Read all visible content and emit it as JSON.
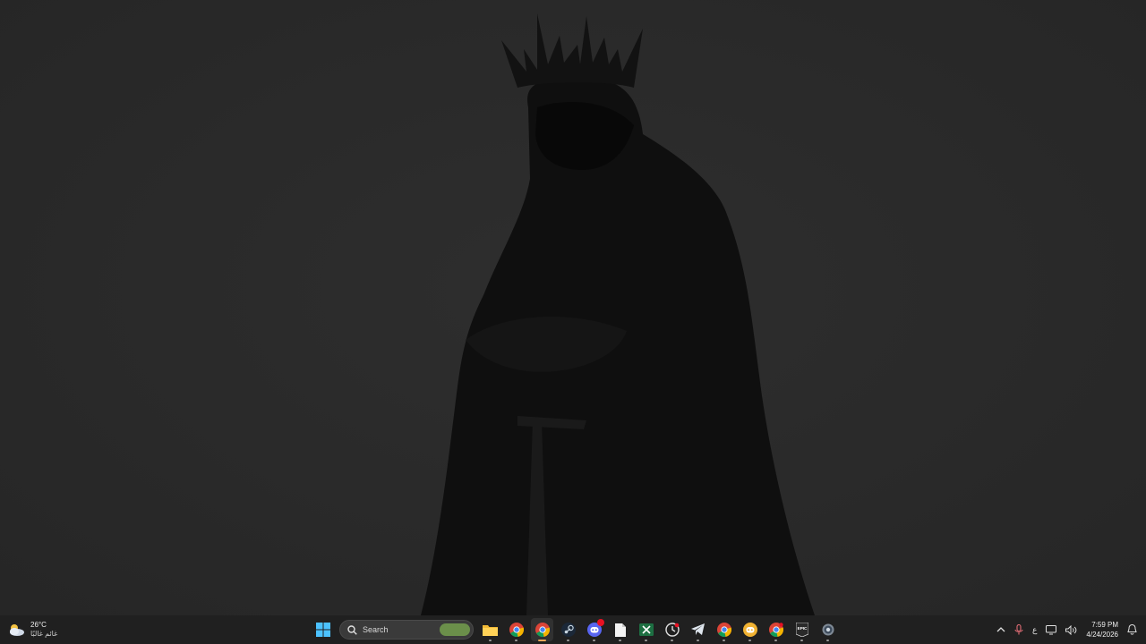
{
  "colors": {
    "desktop_bg": "#2b2b2b",
    "taskbar_bg": "#202020",
    "accent_running": "#e8a657",
    "badge_red": "#e81123"
  },
  "weather": {
    "temperature": "26°C",
    "condition": "غائم غالبًا",
    "icon": "partly-cloudy-icon"
  },
  "taskbar": {
    "start_icon": "windows-start-icon",
    "search": {
      "placeholder": "Search",
      "icon": "search-icon"
    },
    "apps": [
      {
        "id": "file-explorer",
        "icon": "folder-icon"
      },
      {
        "id": "chrome-1",
        "icon": "chrome-icon"
      },
      {
        "id": "chrome-2",
        "icon": "chrome-icon"
      },
      {
        "id": "steam",
        "icon": "steam-icon"
      },
      {
        "id": "discord",
        "icon": "discord-icon",
        "badge": ""
      },
      {
        "id": "notepad",
        "icon": "document-icon"
      },
      {
        "id": "excel",
        "icon": "excel-icon"
      },
      {
        "id": "clock-app",
        "icon": "clock-icon"
      },
      {
        "id": "telegram",
        "icon": "telegram-icon"
      },
      {
        "id": "chrome-3",
        "icon": "chrome-icon"
      },
      {
        "id": "discord-ptb",
        "icon": "discord-yellow-icon"
      },
      {
        "id": "chrome-4",
        "icon": "chrome-icon"
      },
      {
        "id": "epic-games",
        "icon": "epic-games-icon",
        "label": "EPIC"
      },
      {
        "id": "settings",
        "icon": "gear-icon"
      }
    ]
  },
  "tray": {
    "chevron_icon": "chevron-up-icon",
    "mic_icon": "microphone-icon",
    "language": "ع",
    "display_icon": "display-icon",
    "volume_icon": "volume-icon",
    "time": "7:59 PM",
    "date": "4/24/2026",
    "notification_icon": "notification-icon"
  }
}
